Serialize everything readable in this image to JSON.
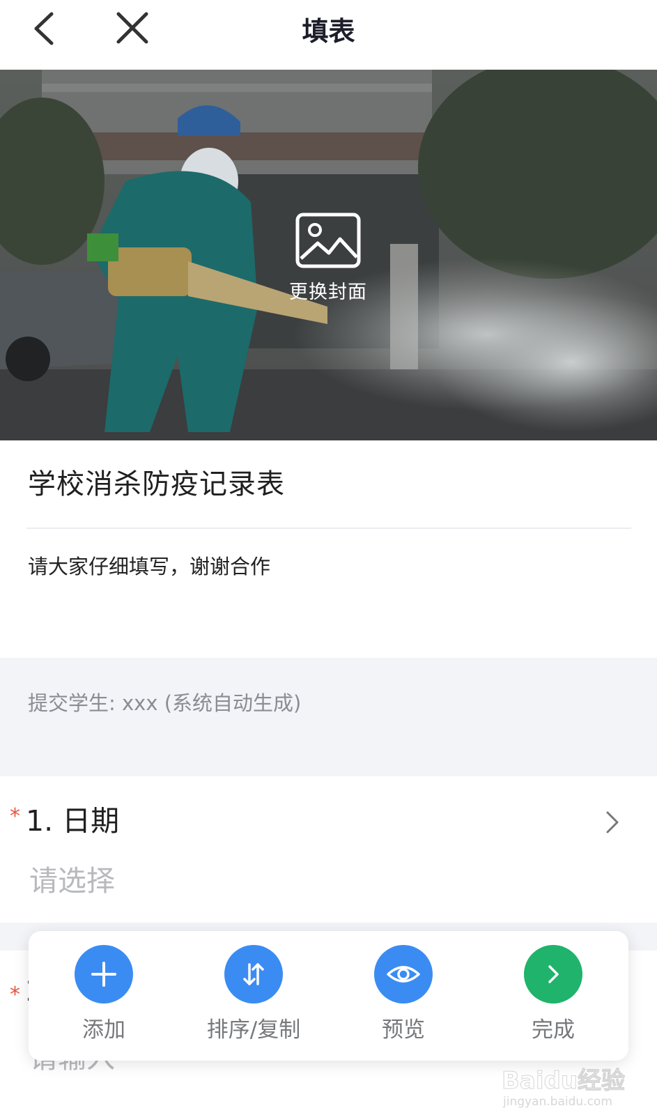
{
  "header": {
    "title": "填表"
  },
  "cover": {
    "change_label": "更换封面"
  },
  "form": {
    "title": "学校消杀防疫记录表",
    "description": "请大家仔细填写，谢谢合作"
  },
  "system": {
    "text": "提交学生: xxx (系统自动生成)"
  },
  "questions": [
    {
      "required_mark": "*",
      "title": "1. 日期",
      "placeholder": "请选择"
    },
    {
      "required_mark": "*",
      "number": "2",
      "placeholder": "请输入"
    }
  ],
  "toolbar": {
    "items": [
      {
        "label": "添加",
        "icon": "plus-icon",
        "color": "#3b8cf2"
      },
      {
        "label": "排序/复制",
        "icon": "sort-icon",
        "color": "#3b8cf2"
      },
      {
        "label": "预览",
        "icon": "eye-icon",
        "color": "#3b8cf2"
      },
      {
        "label": "完成",
        "icon": "chevron-right-icon",
        "color": "#1fb36b"
      }
    ]
  },
  "watermark": {
    "text": "Baidu经验",
    "sub": "jingyan.baidu.com"
  }
}
